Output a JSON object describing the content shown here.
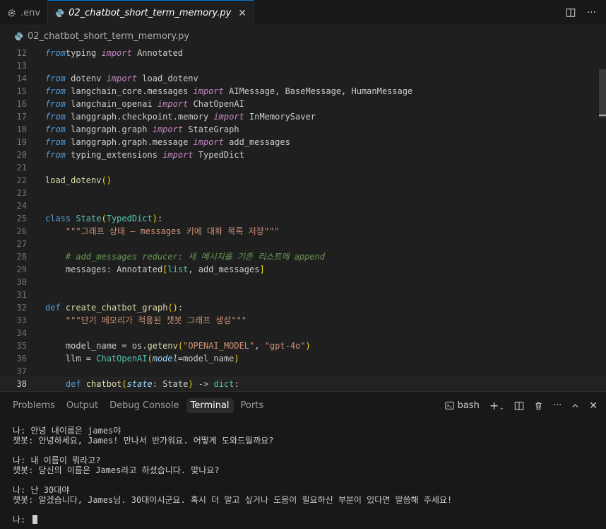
{
  "tabs": [
    {
      "label": ".env",
      "icon": "gear-icon",
      "active": false
    },
    {
      "label": "02_chatbot_short_term_memory.py",
      "icon": "python-icon",
      "active": true
    }
  ],
  "breadcrumb": {
    "file": "02_chatbot_short_term_memory.py"
  },
  "editor": {
    "current_line": "38",
    "lines": [
      {
        "n": "12",
        "tokens": [
          [
            "kw",
            "from"
          ],
          [
            "",
            "typing "
          ],
          [
            "imp",
            "import"
          ],
          [
            "",
            " Annotated"
          ]
        ]
      },
      {
        "n": "13",
        "tokens": []
      },
      {
        "n": "14",
        "tokens": [
          [
            "kw",
            "from"
          ],
          [
            "",
            " dotenv "
          ],
          [
            "imp",
            "import"
          ],
          [
            "",
            " load_dotenv"
          ]
        ]
      },
      {
        "n": "15",
        "tokens": [
          [
            "kw",
            "from"
          ],
          [
            "",
            " langchain_core.messages "
          ],
          [
            "imp",
            "import"
          ],
          [
            "",
            " AIMessage, BaseMessage, HumanMessage"
          ]
        ]
      },
      {
        "n": "16",
        "tokens": [
          [
            "kw",
            "from"
          ],
          [
            "",
            " langchain_openai "
          ],
          [
            "imp",
            "import"
          ],
          [
            "",
            " ChatOpenAI"
          ]
        ]
      },
      {
        "n": "17",
        "tokens": [
          [
            "kw",
            "from"
          ],
          [
            "",
            " langgraph.checkpoint.memory "
          ],
          [
            "imp",
            "import"
          ],
          [
            "",
            " InMemorySaver"
          ]
        ]
      },
      {
        "n": "18",
        "tokens": [
          [
            "kw",
            "from"
          ],
          [
            "",
            " langgraph.graph "
          ],
          [
            "imp",
            "import"
          ],
          [
            "",
            " StateGraph"
          ]
        ]
      },
      {
        "n": "19",
        "tokens": [
          [
            "kw",
            "from"
          ],
          [
            "",
            " langgraph.graph.message "
          ],
          [
            "imp",
            "import"
          ],
          [
            "",
            " add_messages"
          ]
        ]
      },
      {
        "n": "20",
        "tokens": [
          [
            "kw",
            "from"
          ],
          [
            "",
            " typing_extensions "
          ],
          [
            "imp",
            "import"
          ],
          [
            "",
            " TypedDict"
          ]
        ]
      },
      {
        "n": "21",
        "tokens": []
      },
      {
        "n": "22",
        "tokens": [
          [
            "fn",
            "load_dotenv"
          ],
          [
            "br1",
            "()"
          ]
        ]
      },
      {
        "n": "23",
        "tokens": []
      },
      {
        "n": "24",
        "tokens": []
      },
      {
        "n": "25",
        "tokens": [
          [
            "kwd",
            "class"
          ],
          [
            "",
            " "
          ],
          [
            "cls",
            "State"
          ],
          [
            "br1",
            "("
          ],
          [
            "cls",
            "TypedDict"
          ],
          [
            "br1",
            ")"
          ],
          [
            "",
            ":"
          ]
        ]
      },
      {
        "n": "26",
        "tokens": [
          [
            "",
            "    "
          ],
          [
            "doc",
            "\"\"\"그래프 상태 — messages 키에 대화 목록 저장\"\"\""
          ]
        ]
      },
      {
        "n": "27",
        "tokens": []
      },
      {
        "n": "28",
        "tokens": [
          [
            "",
            "    "
          ],
          [
            "cmt",
            "# add_messages reducer: 새 메시지를 기존 리스트에 append"
          ]
        ]
      },
      {
        "n": "29",
        "tokens": [
          [
            "",
            "    messages: Annotated"
          ],
          [
            "br1",
            "["
          ],
          [
            "cls",
            "list"
          ],
          [
            "",
            ", add_messages"
          ],
          [
            "br1",
            "]"
          ]
        ]
      },
      {
        "n": "30",
        "tokens": []
      },
      {
        "n": "31",
        "tokens": []
      },
      {
        "n": "32",
        "tokens": [
          [
            "kwd",
            "def"
          ],
          [
            "",
            " "
          ],
          [
            "fn",
            "create_chatbot_graph"
          ],
          [
            "br1",
            "()"
          ],
          [
            "",
            ":"
          ]
        ]
      },
      {
        "n": "33",
        "tokens": [
          [
            "",
            "    "
          ],
          [
            "doc",
            "\"\"\"단기 메모리가 적용된 챗봇 그래프 생성\"\"\""
          ]
        ]
      },
      {
        "n": "34",
        "tokens": []
      },
      {
        "n": "35",
        "tokens": [
          [
            "",
            "    model_name = os."
          ],
          [
            "fn",
            "getenv"
          ],
          [
            "br1",
            "("
          ],
          [
            "str",
            "\"OPENAI_MODEL\""
          ],
          [
            "",
            ", "
          ],
          [
            "str",
            "\"gpt-4o\""
          ],
          [
            "br1",
            ")"
          ]
        ]
      },
      {
        "n": "36",
        "tokens": [
          [
            "",
            "    llm = "
          ],
          [
            "cls",
            "ChatOpenAI"
          ],
          [
            "br1",
            "("
          ],
          [
            "prm",
            "model"
          ],
          [
            "",
            "=model_name"
          ],
          [
            "br1",
            ")"
          ]
        ]
      },
      {
        "n": "37",
        "tokens": []
      },
      {
        "n": "38",
        "tokens": [
          [
            "",
            "    "
          ],
          [
            "kwd",
            "def"
          ],
          [
            "",
            " "
          ],
          [
            "fn",
            "chatbot"
          ],
          [
            "br1",
            "("
          ],
          [
            "prm",
            "state"
          ],
          [
            "",
            ": State"
          ],
          [
            "br1",
            ")"
          ],
          [
            "",
            " -> "
          ],
          [
            "cls",
            "dict"
          ],
          [
            "",
            ":"
          ]
        ]
      }
    ]
  },
  "panel": {
    "tabs": [
      "Problems",
      "Output",
      "Debug Console",
      "Terminal",
      "Ports"
    ],
    "active_tab": "Terminal",
    "shell": "bash",
    "terminal_lines": [
      "나: 안녕 내이름은 james야",
      "챗봇: 안녕하세요, James! 만나서 반가워요. 어떻게 도와드릴까요?",
      "",
      "나: 내 이름이 뭐라고?",
      "챗봇: 당신의 이름은 James라고 하셨습니다. 맞나요?",
      "",
      "나: 난 30대야",
      "챗봇: 알겠습니다, James님. 30대이시군요. 혹시 더 알고 싶거나 도움이 필요하신 부분이 있다면 말씀해 주세요!",
      ""
    ],
    "prompt": "나: "
  },
  "colors": {
    "accent": "#0078d4",
    "background": "#1f1f1f",
    "keyword": "#569cd6",
    "import": "#c586c0",
    "function": "#dcdcaa",
    "class": "#4ec9b0",
    "string": "#ce9178",
    "comment": "#6a9955"
  }
}
